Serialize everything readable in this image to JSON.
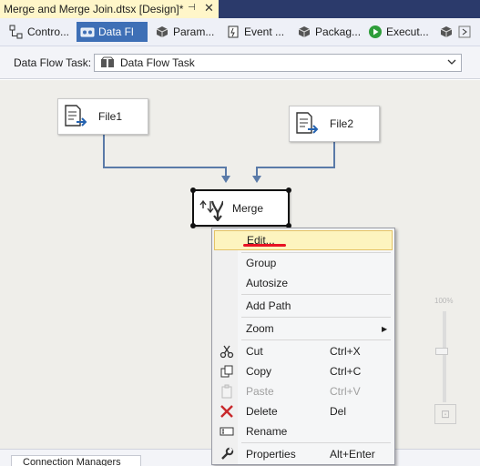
{
  "document_tab": {
    "title": "Merge and Merge Join.dtsx [Design]*",
    "pin_glyph": "⊣",
    "close_glyph": "✕"
  },
  "designer_tabs": [
    {
      "label": "Contro...",
      "icon": "control-flow-icon",
      "active": false
    },
    {
      "label": "Data Fl",
      "icon": "data-flow-icon",
      "active": true
    },
    {
      "label": "Param...",
      "icon": "parameters-icon",
      "active": false
    },
    {
      "label": "Event ...",
      "icon": "event-handlers-icon",
      "active": false
    },
    {
      "label": "Packag...",
      "icon": "package-explorer-icon",
      "active": false
    },
    {
      "label": "Execut...",
      "icon": "execute-icon",
      "active": false
    }
  ],
  "task_selector": {
    "label": "Data Flow Task:",
    "value": "Data Flow Task"
  },
  "components": {
    "file1": {
      "label": "File1"
    },
    "file2": {
      "label": "File2"
    },
    "merge": {
      "label": "Merge"
    }
  },
  "zoom": {
    "percent": "100%",
    "fit_glyph": "⊡"
  },
  "bottom": {
    "connection_managers_label": "Connection Managers"
  },
  "context_menu": {
    "items": [
      {
        "label": "Edit...",
        "shortcut": "",
        "icon": "",
        "disabled": false,
        "hover": true
      },
      {
        "label": "Group",
        "shortcut": "",
        "icon": "",
        "disabled": false
      },
      {
        "label": "Autosize",
        "shortcut": "",
        "icon": "",
        "disabled": false
      },
      {
        "label": "Add Path",
        "shortcut": "",
        "icon": "",
        "disabled": false
      },
      {
        "label": "Zoom",
        "shortcut": "",
        "icon": "",
        "disabled": false,
        "submenu": true
      },
      {
        "label": "Cut",
        "shortcut": "Ctrl+X",
        "icon": "scissors-icon",
        "disabled": false
      },
      {
        "label": "Copy",
        "shortcut": "Ctrl+C",
        "icon": "copy-icon",
        "disabled": false
      },
      {
        "label": "Paste",
        "shortcut": "Ctrl+V",
        "icon": "paste-icon",
        "disabled": true
      },
      {
        "label": "Delete",
        "shortcut": "Del",
        "icon": "delete-icon",
        "disabled": false
      },
      {
        "label": "Rename",
        "shortcut": "",
        "icon": "rename-icon",
        "disabled": false
      },
      {
        "label": "Properties",
        "shortcut": "Alt+Enter",
        "icon": "wrench-icon",
        "disabled": false
      }
    ]
  },
  "colors": {
    "tab_strip": "#2b3a6b",
    "active_doc_tab": "#fff6c9",
    "active_designer_tab": "#3e6fb6",
    "canvas": "#efeeea",
    "connector": "#5a7aa8",
    "menu_hover": "#fdf4bf",
    "annotation_underline": "#e81123"
  }
}
